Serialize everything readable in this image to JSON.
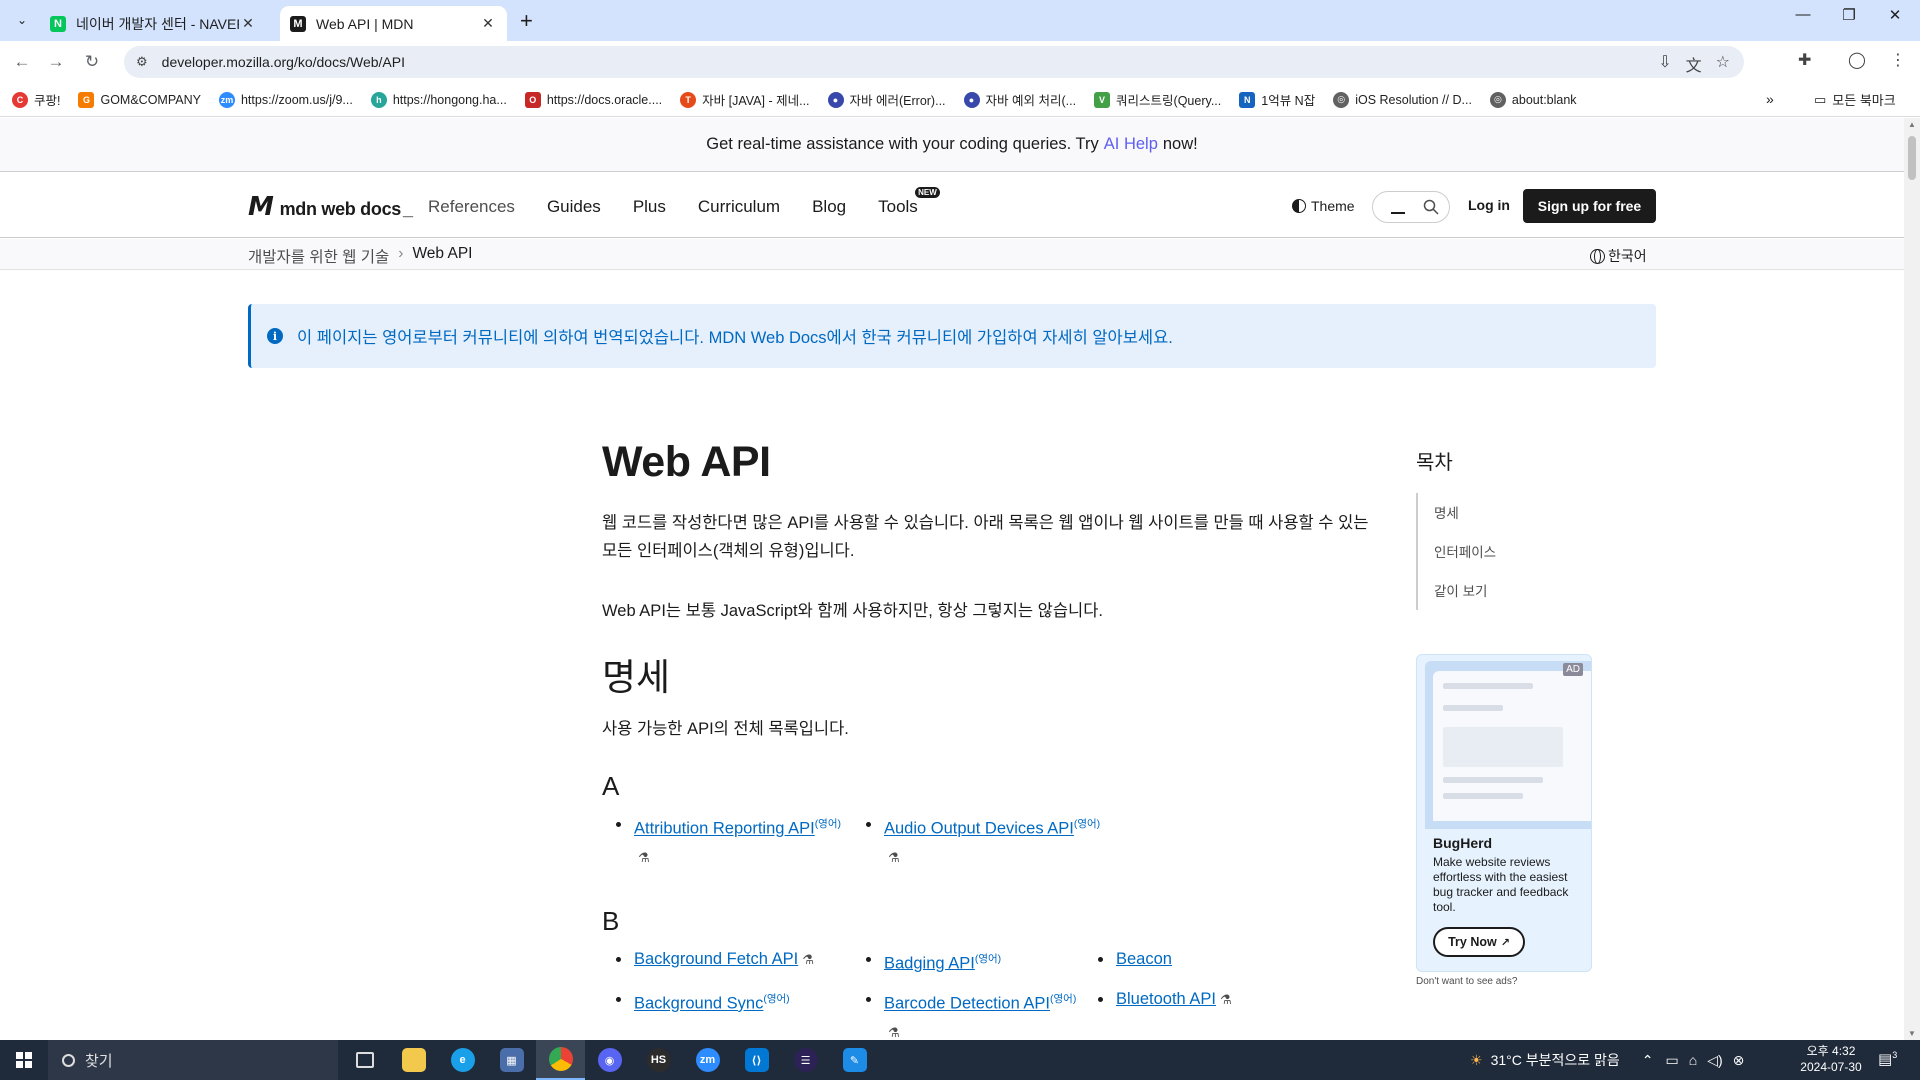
{
  "browser": {
    "tabs": [
      {
        "title": "네이버 개발자 센터 - NAVER D",
        "favicon": "N",
        "favicon_color": "#03c75a",
        "active": false
      },
      {
        "title": "Web API | MDN",
        "favicon": "M",
        "favicon_color": "#1b1b1b",
        "active": true
      }
    ],
    "url": "developer.mozilla.org/ko/docs/Web/API",
    "bookmarks": [
      {
        "label": "쿠팡!",
        "color": "#e53935"
      },
      {
        "label": "GOM&COMPANY",
        "color": "#f57c00"
      },
      {
        "label": "https://zoom.us/j/9...",
        "color": "#2d8cff"
      },
      {
        "label": "https://hongong.ha...",
        "color": "#26a69a"
      },
      {
        "label": "https://docs.oracle....",
        "color": "#c62828"
      },
      {
        "label": "자바 [JAVA] - 제네...",
        "color": "#e64a19"
      },
      {
        "label": "자바 에러(Error)...",
        "color": "#3949ab"
      },
      {
        "label": "자바 예외 처리(...",
        "color": "#3949ab"
      },
      {
        "label": "쿼리스트링(Query...",
        "color": "#43a047"
      },
      {
        "label": "1억뷰 N잡",
        "color": "#1565c0"
      },
      {
        "label": "iOS Resolution // D...",
        "color": "#616161"
      },
      {
        "label": "about:blank",
        "color": "#616161"
      }
    ],
    "bookmarks_more": "»",
    "all_bookmarks": "모든 북마크"
  },
  "banner": {
    "prefix": "Get real-time assistance with your coding queries. Try",
    "link": "AI Help",
    "suffix": "now!"
  },
  "header": {
    "logo": "mdn web docs",
    "nav": [
      "References",
      "Guides",
      "Plus",
      "Curriculum",
      "Blog",
      "Tools"
    ],
    "tools_badge": "NEW",
    "theme": "Theme",
    "login": "Log in",
    "signup": "Sign up for free"
  },
  "breadcrumb": {
    "parent": "개발자를 위한 웹 기술",
    "current": "Web API",
    "language": "한국어"
  },
  "notice": "이 페이지는 영어로부터 커뮤니티에 의하여 번역되었습니다. MDN Web Docs에서 한국 커뮤니티에 가입하여 자세히 알아보세요.",
  "article": {
    "title": "Web API",
    "intro": "웹 코드를 작성한다면 많은 API를 사용할 수 있습니다. 아래 목록은 웹 앱이나 웹 사이트를 만들 때 사용할 수 있는 모든 인터페이스(객체의 유형)입니다.",
    "para2": "Web API는 보통 JavaScript와 함께 사용하지만, 항상 그렇지는 않습니다.",
    "spec_heading": "명세",
    "spec_lead": "사용 가능한 API의 전체 목록입니다.",
    "groups": [
      {
        "letter": "A",
        "items": [
          {
            "label": "Attribution Reporting API",
            "sup": "(영어)",
            "experimental": true
          },
          {
            "label": "Audio Output Devices API",
            "sup": "(영어)",
            "experimental": true
          }
        ]
      },
      {
        "letter": "B",
        "items": [
          {
            "label": "Background Fetch API",
            "sup": "",
            "experimental": true
          },
          {
            "label": "Badging API",
            "sup": "(영어)",
            "experimental": false
          },
          {
            "label": "Beacon",
            "sup": "",
            "experimental": false
          },
          {
            "label": "Background Sync",
            "sup": "(영어)",
            "experimental": false
          },
          {
            "label": "Barcode Detection API",
            "sup": "(영어)",
            "experimental": true
          },
          {
            "label": "Bluetooth API",
            "sup": "",
            "experimental": true
          }
        ]
      }
    ]
  },
  "toc": {
    "title": "목차",
    "items": [
      "명세",
      "인터페이스",
      "같이 보기"
    ]
  },
  "ad": {
    "badge": "AD",
    "name": "BugHerd",
    "desc": "Make website reviews effortless with the easiest bug tracker and feedback tool.",
    "cta": "Try Now",
    "no_ads": "Don't want to see ads?"
  },
  "taskbar": {
    "search": "찾기",
    "weather": "31°C  부분적으로 맑음",
    "time": "오후 4:32",
    "date": "2024-07-30",
    "notifications": "3"
  }
}
